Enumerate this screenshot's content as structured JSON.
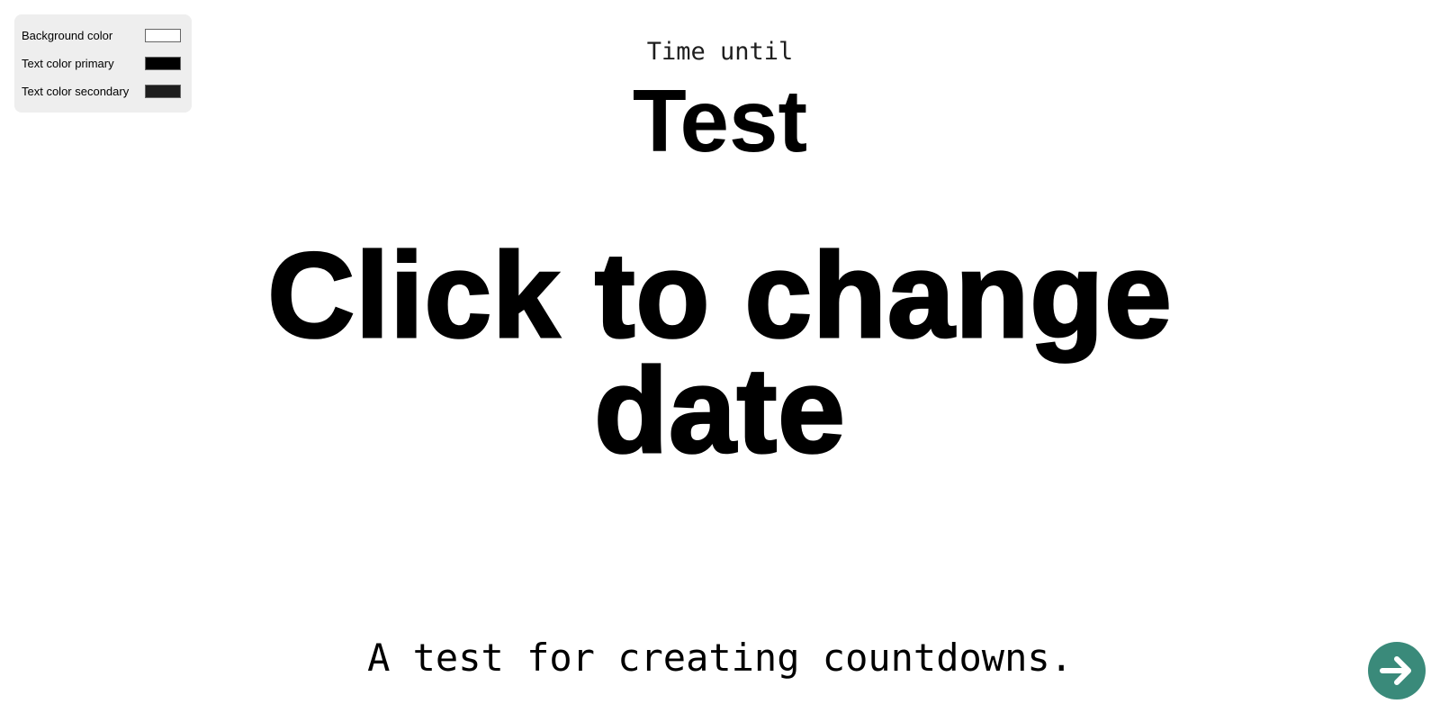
{
  "settings": {
    "items": [
      {
        "label": "Background color",
        "color": "#ffffff"
      },
      {
        "label": "Text color primary",
        "color": "#000000"
      },
      {
        "label": "Text color secondary",
        "color": "#1e1e1e"
      }
    ]
  },
  "countdown": {
    "prefix": "Time until",
    "title": "Test",
    "value": "Click to change date",
    "description": "A test for creating countdowns."
  },
  "next_button": {
    "icon": "arrow-right-icon",
    "color": "#3a8a7a"
  }
}
